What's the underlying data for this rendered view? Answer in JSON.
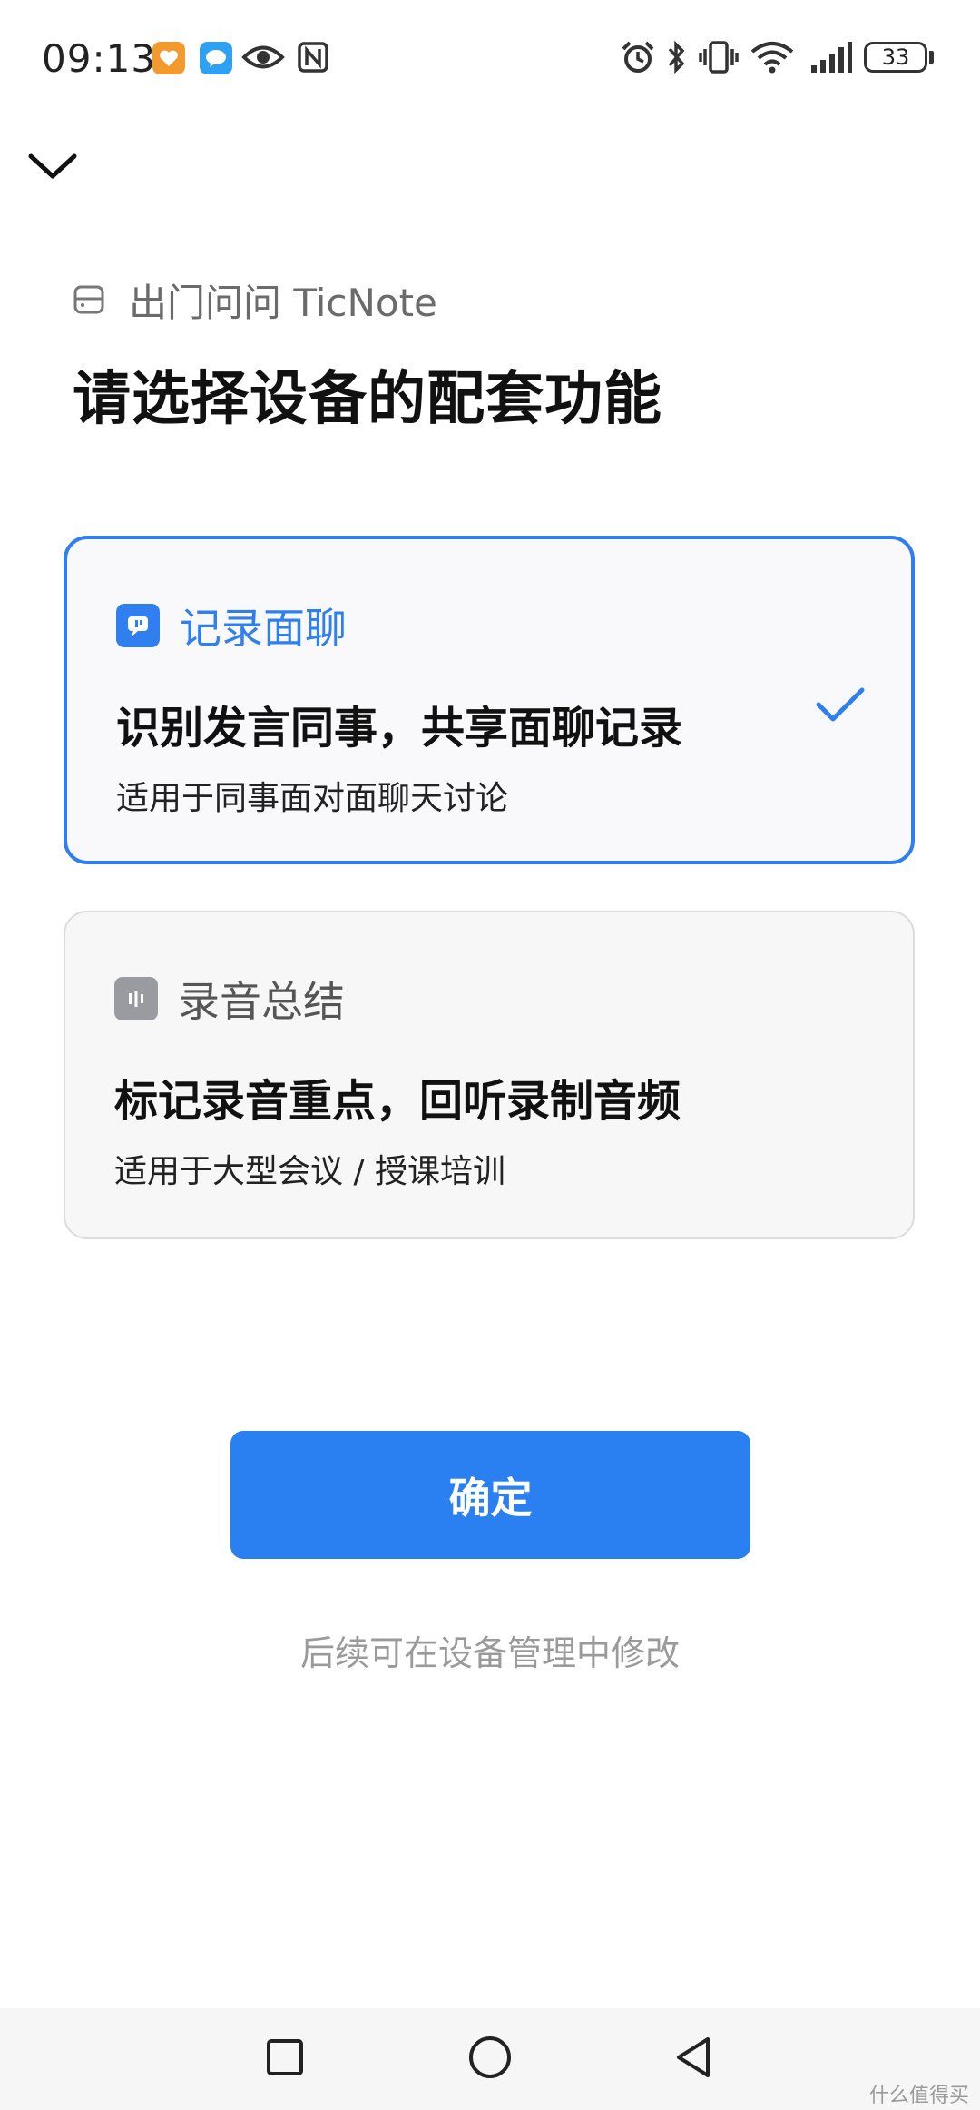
{
  "status_bar": {
    "time": "09:13",
    "battery": "33",
    "icons": [
      "app-orange-icon",
      "app-chat-icon",
      "eye-icon",
      "nfc-icon",
      "alarm-icon",
      "bluetooth-icon",
      "vibrate-icon",
      "wifi-icon",
      "signal-icon",
      "battery-icon"
    ]
  },
  "header": {
    "back_icon": "chevron-down-icon",
    "device_name": "出门问问 TicNote",
    "title": "请选择设备的配套功能"
  },
  "options": [
    {
      "label": "记录面聊",
      "headline": "识别发言同事，共享面聊记录",
      "description": "适用于同事面对面聊天讨论",
      "selected": true
    },
    {
      "label": "录音总结",
      "headline": "标记录音重点，回听录制音频",
      "description": "适用于大型会议 / 授课培训",
      "selected": false
    }
  ],
  "confirm_label": "确定",
  "hint": "后续可在设备管理中修改",
  "watermark": "什么值得买",
  "colors": {
    "accent": "#2b80f1",
    "selected_border": "#2f7ff0"
  }
}
